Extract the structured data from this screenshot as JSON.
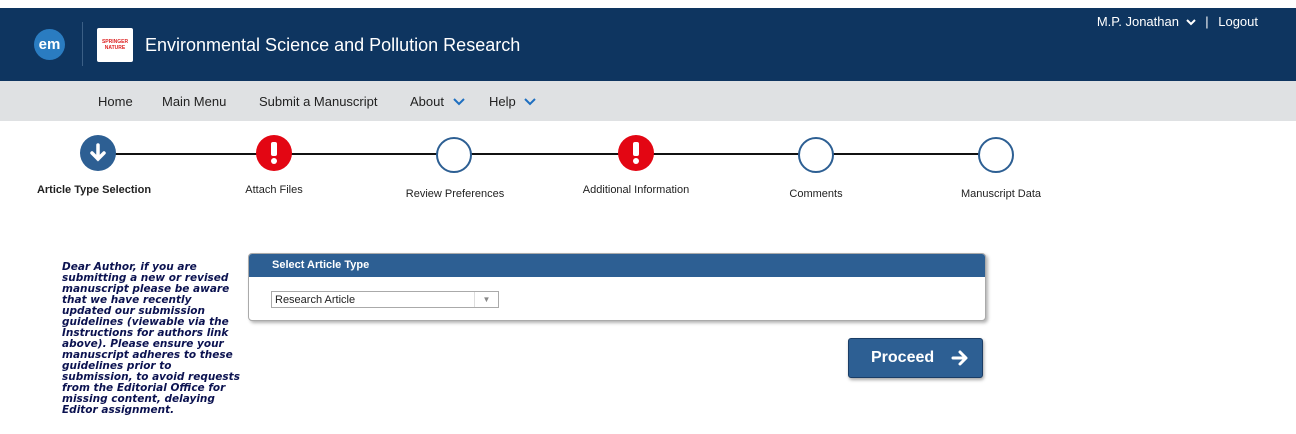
{
  "header": {
    "logo_text": "em",
    "publisher_logo": [
      "SPRINGER",
      "NATURE"
    ],
    "journal_title": "Environmental Science and Pollution Research",
    "user_name": "M.P. Jonathan",
    "separator": "|",
    "logout": "Logout"
  },
  "nav": {
    "items": [
      {
        "label": "Home"
      },
      {
        "label": "Main Menu"
      },
      {
        "label": "Submit a Manuscript"
      },
      {
        "label": "About"
      },
      {
        "label": "Help"
      }
    ]
  },
  "steps": [
    {
      "label": "Article Type Selection",
      "state": "current"
    },
    {
      "label": "Attach Files",
      "state": "error"
    },
    {
      "label": "Review Preferences",
      "state": "empty"
    },
    {
      "label": "Additional Information",
      "state": "error"
    },
    {
      "label": "Comments",
      "state": "empty"
    },
    {
      "label": "Manuscript Data",
      "state": "empty"
    }
  ],
  "notice": "Dear Author, if you are submitting a new or revised manuscript please be aware that we have recently updated our submission guidelines (viewable via the Instructions for authors link above). Please ensure your manuscript adheres to these guidelines prior to submission, to avoid requests from the Editorial Office for missing content, delaying Editor assignment.",
  "article_type": {
    "panel_title": "Select Article Type",
    "selected": "Research Article"
  },
  "proceed_label": "Proceed",
  "colors": {
    "header_bg": "#0e3560",
    "nav_bg": "#dfe1e3",
    "accent": "#2d5f93",
    "error": "#e30613"
  }
}
